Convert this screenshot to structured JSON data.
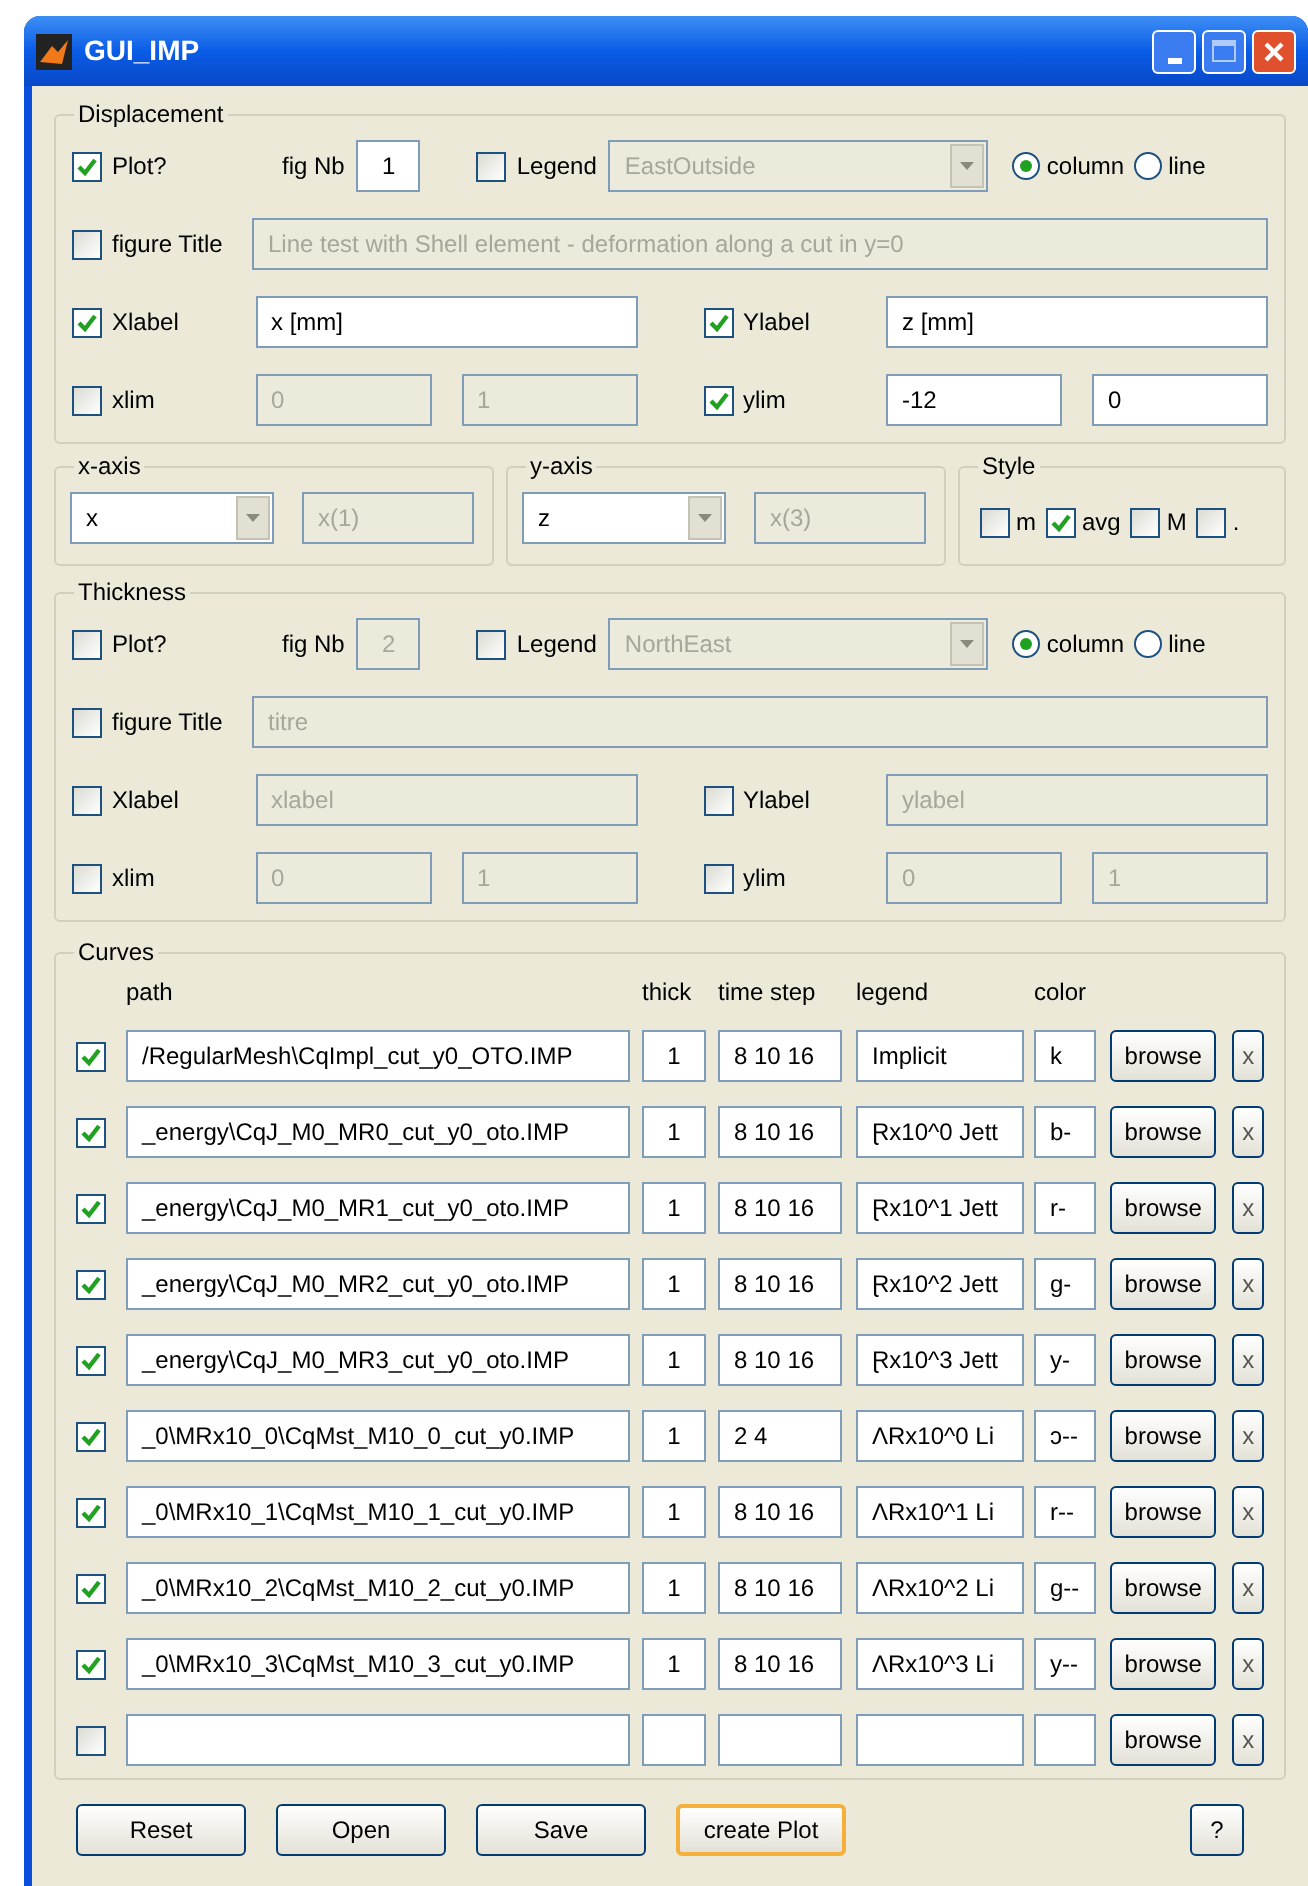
{
  "window": {
    "title": "GUI_IMP"
  },
  "displacement": {
    "title": "Displacement",
    "plot": {
      "label": "Plot?",
      "checked": true
    },
    "fig_nb": {
      "label": "fig Nb",
      "value": "1"
    },
    "legend": {
      "label": "Legend",
      "checked": false,
      "value": "EastOutside"
    },
    "orientation": [
      {
        "label": "column",
        "selected": true
      },
      {
        "label": "line",
        "selected": false
      }
    ],
    "figure_title": {
      "label": "figure Title",
      "checked": false,
      "value": "Line test with Shell element - deformation along a cut in y=0"
    },
    "xlabel": {
      "label": "Xlabel",
      "checked": true,
      "value": "x [mm]"
    },
    "ylabel": {
      "label": "Ylabel",
      "checked": true,
      "value": "z [mm]"
    },
    "xlim": {
      "label": "xlim",
      "checked": false,
      "values": [
        "0",
        "1"
      ]
    },
    "ylim": {
      "label": "ylim",
      "checked": true,
      "values": [
        "-12",
        "0"
      ]
    }
  },
  "x_axis": {
    "title": "x-axis",
    "value": "x",
    "field": "x(1)"
  },
  "y_axis": {
    "title": "y-axis",
    "value": "z",
    "field": "x(3)"
  },
  "style": {
    "title": "Style",
    "options": [
      {
        "label": "m",
        "checked": false
      },
      {
        "label": "avg",
        "checked": true
      },
      {
        "label": "M",
        "checked": false
      },
      {
        "label": ".",
        "checked": false
      }
    ]
  },
  "thickness": {
    "title": "Thickness",
    "plot": {
      "label": "Plot?",
      "checked": false
    },
    "fig_nb": {
      "label": "fig Nb",
      "value": "2"
    },
    "legend": {
      "label": "Legend",
      "checked": false,
      "value": "NorthEast"
    },
    "orientation": [
      {
        "label": "column",
        "selected": true
      },
      {
        "label": "line",
        "selected": false
      }
    ],
    "figure_title": {
      "label": "figure Title",
      "checked": false,
      "value": "titre"
    },
    "xlabel": {
      "label": "Xlabel",
      "checked": false,
      "value": "xlabel"
    },
    "ylabel": {
      "label": "Ylabel",
      "checked": false,
      "value": "ylabel"
    },
    "xlim": {
      "label": "xlim",
      "checked": false,
      "values": [
        "0",
        "1"
      ]
    },
    "ylim": {
      "label": "ylim",
      "checked": false,
      "values": [
        "0",
        "1"
      ]
    }
  },
  "curves": {
    "title": "Curves",
    "columns": [
      "path",
      "thick",
      "time step",
      "legend",
      "color"
    ],
    "rows": [
      {
        "checked": true,
        "path": "/RegularMesh\\CqImpl_cut_y0_OTO.IMP",
        "thick": "1",
        "time_step": "8 10 16",
        "legend": "Implicit",
        "color_code": "k",
        "browse": "browse",
        "remove": "x"
      },
      {
        "checked": true,
        "path": "_energy\\CqJ_M0_MR0_cut_y0_oto.IMP",
        "thick": "1",
        "time_step": "8 10 16",
        "legend": "Ɽx10^0 Jett",
        "color_code": "b-",
        "browse": "browse",
        "remove": "x"
      },
      {
        "checked": true,
        "path": "_energy\\CqJ_M0_MR1_cut_y0_oto.IMP",
        "thick": "1",
        "time_step": "8 10 16",
        "legend": "Ɽx10^1 Jett",
        "color_code": "r-",
        "browse": "browse",
        "remove": "x"
      },
      {
        "checked": true,
        "path": "_energy\\CqJ_M0_MR2_cut_y0_oto.IMP",
        "thick": "1",
        "time_step": "8 10 16",
        "legend": "Ɽx10^2 Jett",
        "color_code": "g-",
        "browse": "browse",
        "remove": "x"
      },
      {
        "checked": true,
        "path": "_energy\\CqJ_M0_MR3_cut_y0_oto.IMP",
        "thick": "1",
        "time_step": "8 10 16",
        "legend": "Ɽx10^3 Jett",
        "color_code": "y-",
        "browse": "browse",
        "remove": "x"
      },
      {
        "checked": true,
        "path": "_0\\MRx10_0\\CqMst_M10_0_cut_y0.IMP",
        "thick": "1",
        "time_step": "2 4",
        "legend": "ΛRx10^0 Li",
        "color_code": "ɔ--",
        "browse": "browse",
        "remove": "x"
      },
      {
        "checked": true,
        "path": "_0\\MRx10_1\\CqMst_M10_1_cut_y0.IMP",
        "thick": "1",
        "time_step": "8 10 16",
        "legend": "ΛRx10^1 Li",
        "color_code": "r--",
        "browse": "browse",
        "remove": "x"
      },
      {
        "checked": true,
        "path": "_0\\MRx10_2\\CqMst_M10_2_cut_y0.IMP",
        "thick": "1",
        "time_step": "8 10 16",
        "legend": "ΛRx10^2 Li",
        "color_code": "ɡ--",
        "browse": "browse",
        "remove": "x"
      },
      {
        "checked": true,
        "path": "_0\\MRx10_3\\CqMst_M10_3_cut_y0.IMP",
        "thick": "1",
        "time_step": "8 10 16",
        "legend": "ΛRx10^3 Li",
        "color_code": "y--",
        "browse": "browse",
        "remove": "x"
      },
      {
        "checked": false,
        "browse": "browse",
        "remove": "x"
      }
    ]
  },
  "buttons": [
    {
      "label": "Reset",
      "focused": false
    },
    {
      "label": "Open",
      "focused": false
    },
    {
      "label": "Save",
      "focused": false
    },
    {
      "label": "create Plot",
      "focused": true
    }
  ],
  "help_button": {
    "label": "?"
  }
}
